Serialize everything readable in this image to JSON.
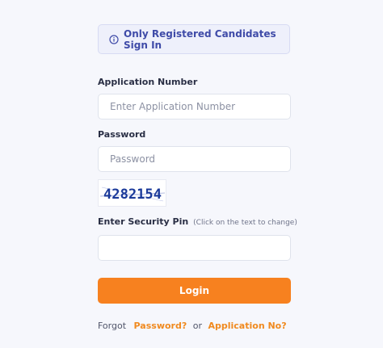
{
  "notice": {
    "icon": "info-icon",
    "text": "Only Registered Candidates Sign In"
  },
  "fields": {
    "application_number": {
      "label": "Application Number",
      "placeholder": "Enter Application Number",
      "value": ""
    },
    "password": {
      "label": "Password",
      "placeholder": "Password",
      "value": ""
    },
    "security_pin": {
      "label": "Enter Security Pin",
      "hint": "(Click on the text to change)",
      "value": ""
    }
  },
  "captcha": {
    "text": "4282154"
  },
  "login_button": {
    "label": "Login"
  },
  "forgot": {
    "prefix": "Forgot",
    "password_link": "Password?",
    "separator": "or",
    "application_link": "Application No?"
  },
  "colors": {
    "accent": "#f7811f",
    "link": "#f08a1f",
    "notice_text": "#3f4ba8",
    "captcha_text": "#1b3a9a"
  }
}
